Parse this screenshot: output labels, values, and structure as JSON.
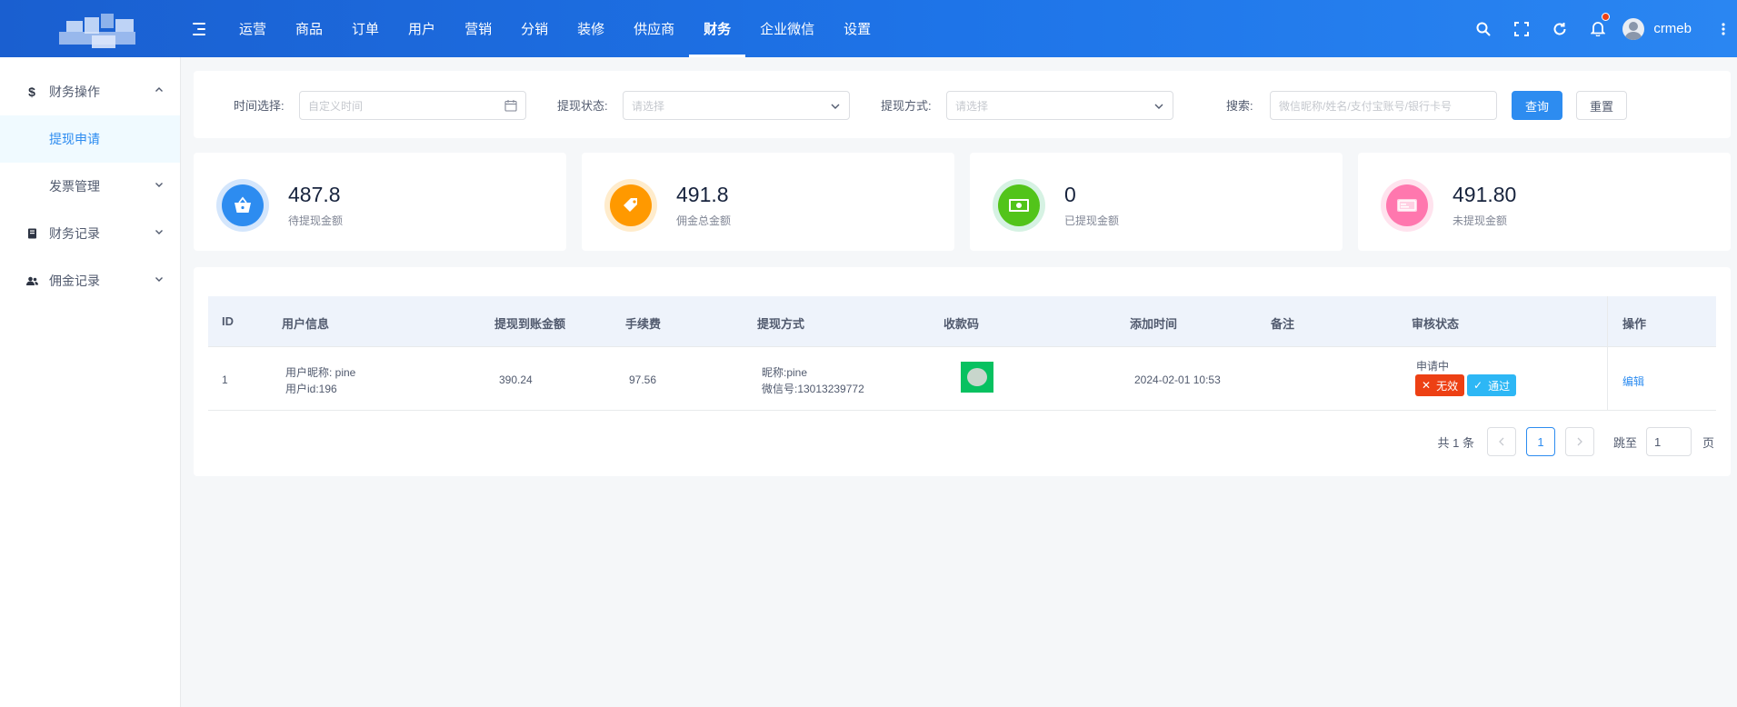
{
  "topnav": {
    "items": [
      "运营",
      "商品",
      "订单",
      "用户",
      "营销",
      "分销",
      "装修",
      "供应商",
      "财务",
      "企业微信",
      "设置"
    ],
    "active_index": 8,
    "username": "crmeb"
  },
  "sidebar": {
    "groups": [
      {
        "label": "财务操作",
        "icon": "dollar-icon",
        "expanded": true
      },
      {
        "label": "提现申请",
        "sub": true,
        "active": true
      },
      {
        "label": "发票管理",
        "sub": true
      },
      {
        "label": "财务记录",
        "icon": "book-icon"
      },
      {
        "label": "佣金记录",
        "icon": "users-icon"
      }
    ]
  },
  "filters": {
    "time_label": "时间选择:",
    "time_placeholder": "自定义时间",
    "status_label": "提现状态:",
    "status_placeholder": "请选择",
    "method_label": "提现方式:",
    "method_placeholder": "请选择",
    "search_label": "搜索:",
    "search_placeholder": "微信昵称/姓名/支付宝账号/银行卡号",
    "query_button": "查询",
    "reset_button": "重置"
  },
  "stats": [
    {
      "value": "487.8",
      "label": "待提现金额",
      "icon": "basket-icon",
      "color": "#2d8cf0",
      "ring": "#d4e6fc"
    },
    {
      "value": "491.8",
      "label": "佣金总金额",
      "icon": "tag-icon",
      "color": "#ff9900",
      "ring": "#ffeccc"
    },
    {
      "value": "0",
      "label": "已提现金额",
      "icon": "cash-icon",
      "color": "#19be6b",
      "ring": "#d6f2e3"
    },
    {
      "value": "491.80",
      "label": "未提现金额",
      "icon": "card-icon",
      "color": "#ff77ae",
      "ring": "#ffe3ee"
    }
  ],
  "table": {
    "headers": [
      "ID",
      "用户信息",
      "提现到账金额",
      "手续费",
      "提现方式",
      "收款码",
      "添加时间",
      "备注",
      "审核状态",
      "操作"
    ],
    "rows": [
      {
        "id": "1",
        "user_nickname": "用户昵称: pine",
        "user_id": "用户id:196",
        "amount": "390.24",
        "fee": "97.56",
        "method_line1": "昵称:pine",
        "method_line2": "微信号:13013239772",
        "added_time": "2024-02-01 10:53",
        "remark": "",
        "status": "申请中",
        "reject_label": "无效",
        "approve_label": "通过",
        "action": "编辑"
      }
    ]
  },
  "pagination": {
    "total": "共 1 条",
    "current": "1",
    "jump_label": "跳至",
    "jump_value": "1",
    "page_suffix": "页"
  }
}
